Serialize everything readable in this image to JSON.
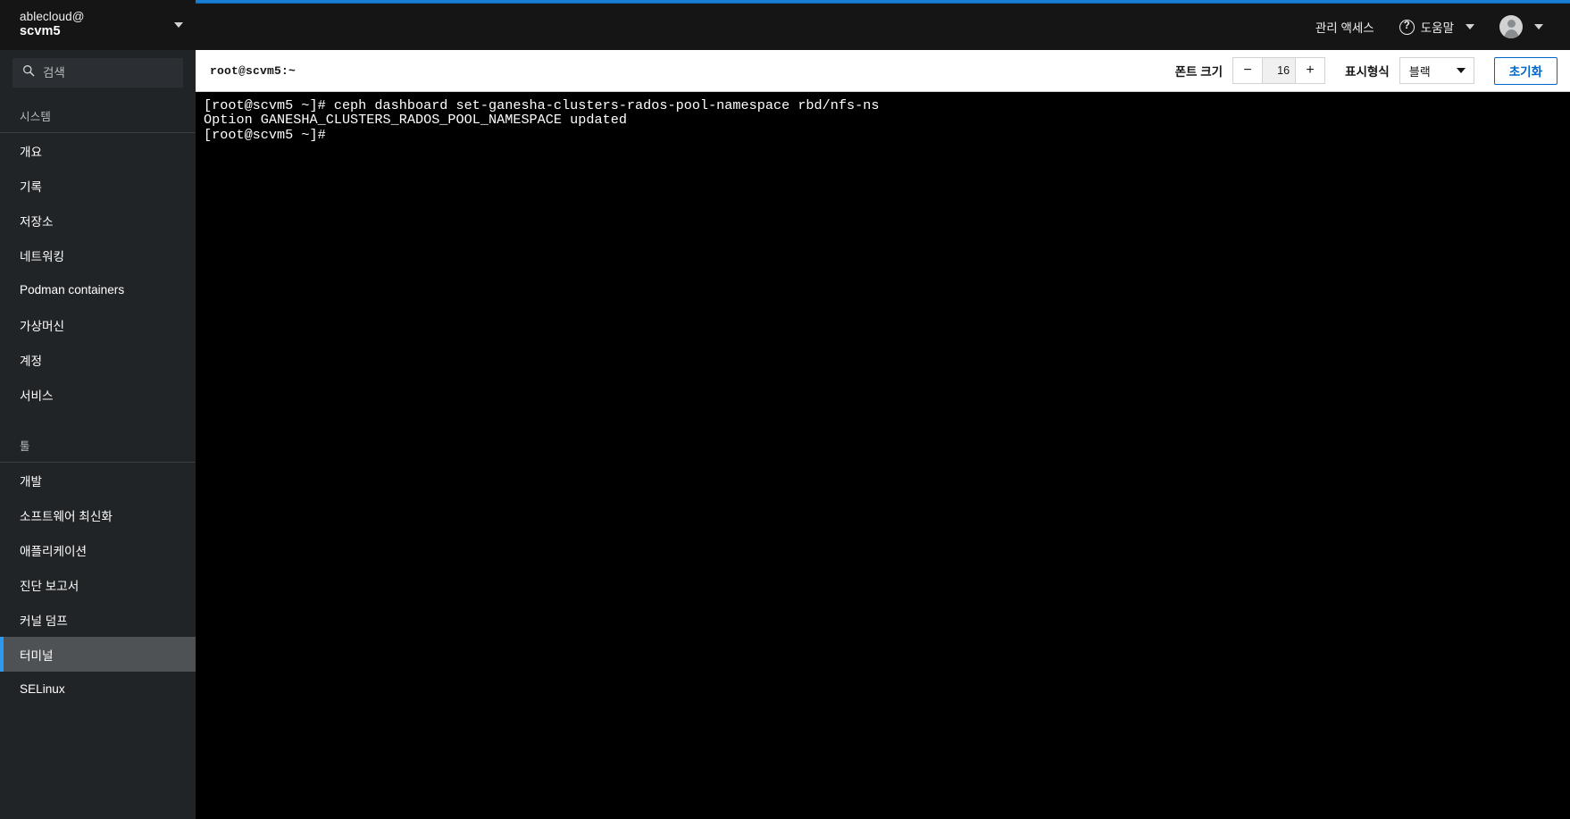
{
  "sidebar": {
    "host": {
      "user": "ablecloud@",
      "name": "scvm5"
    },
    "search": {
      "placeholder": "검색",
      "value": "",
      "icon": "search-icon"
    },
    "groups": [
      {
        "title": "시스템",
        "items": [
          {
            "label": "개요",
            "selected": false
          },
          {
            "label": "기록",
            "selected": false
          },
          {
            "label": "저장소",
            "selected": false
          },
          {
            "label": "네트워킹",
            "selected": false
          },
          {
            "label": "Podman containers",
            "selected": false
          },
          {
            "label": "가상머신",
            "selected": false
          },
          {
            "label": "계정",
            "selected": false
          },
          {
            "label": "서비스",
            "selected": false
          }
        ]
      },
      {
        "title": "툴",
        "items": [
          {
            "label": "개발",
            "selected": false
          },
          {
            "label": "소프트웨어 최신화",
            "selected": false
          },
          {
            "label": "애플리케이션",
            "selected": false
          },
          {
            "label": "진단 보고서",
            "selected": false
          },
          {
            "label": "커널 덤프",
            "selected": false
          },
          {
            "label": "터미널",
            "selected": true
          },
          {
            "label": "SELinux",
            "selected": false
          }
        ]
      }
    ]
  },
  "topbar": {
    "admin_access_label": "관리 액세스",
    "help_label": "도움말",
    "help_icon": "question-circle-icon",
    "avatar_icon": "user-avatar-icon"
  },
  "terminal": {
    "title": "root@scvm5:~",
    "font_size_label": "폰트 크기",
    "font_size_value": "16",
    "decrease_label": "−",
    "increase_label": "+",
    "theme_label": "표시형식",
    "theme_value": "블랙",
    "reset_label": "초기화",
    "lines": [
      "[root@scvm5 ~]# ceph dashboard set-ganesha-clusters-rados-pool-namespace rbd/nfs-ns",
      "Option GANESHA_CLUSTERS_RADOS_POOL_NAMESPACE updated",
      "[root@scvm5 ~]# "
    ]
  },
  "colors": {
    "accent_blue": "#2b9af3",
    "progress_blue": "#1478cf",
    "link_blue": "#0066cc",
    "sidebar_bg": "#212427",
    "header_bg": "#151515",
    "selected_bg": "#4f5255",
    "terminal_bg": "#000000",
    "terminal_fg": "#ffffff"
  }
}
